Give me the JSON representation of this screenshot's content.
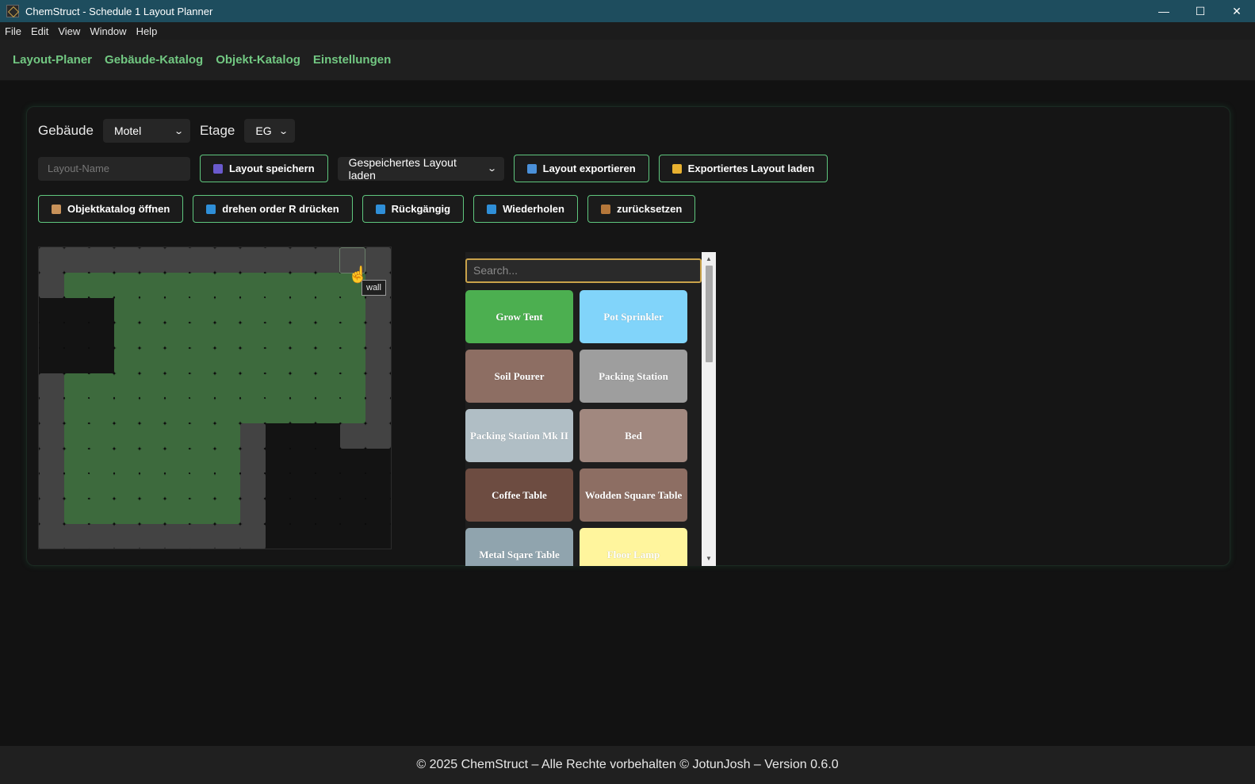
{
  "window": {
    "title": "ChemStruct - Schedule 1 Layout Planner",
    "minimize": "—",
    "maximize": "☐",
    "close": "✕"
  },
  "menu": [
    "File",
    "Edit",
    "View",
    "Window",
    "Help"
  ],
  "nav": [
    "Layout-Planer",
    "Gebäude-Katalog",
    "Objekt-Katalog",
    "Einstellungen"
  ],
  "controls": {
    "building_label": "Gebäude",
    "building_value": "Motel",
    "floor_label": "Etage",
    "floor_value": "EG",
    "layout_name_placeholder": "Layout-Name",
    "save_btn": "Layout speichern",
    "load_saved_select": "Gespeichertes Layout laden",
    "export_btn": "Layout exportieren",
    "load_export_btn": "Exportiertes Layout laden",
    "catalog_btn": "Objektkatalog öffnen",
    "rotate_btn": "drehen order R drücken",
    "undo_btn": "Rückgängig",
    "redo_btn": "Wiederholen",
    "reset_btn": "zurücksetzen"
  },
  "icons": {
    "save": "floppy-disk-icon",
    "export": "outbox-icon",
    "load_export": "folder-icon",
    "catalog": "package-icon",
    "rotate": "rotate-icon",
    "undo": "arrow-left-icon",
    "redo": "arrow-right-icon",
    "reset": "broom-icon"
  },
  "grid": {
    "tooltip": "wall"
  },
  "catalog": {
    "search_placeholder": "Search...",
    "items": [
      {
        "label": "Grow Tent",
        "color": "#4caf50"
      },
      {
        "label": "Pot Sprinkler",
        "color": "#81d4fa"
      },
      {
        "label": "Soil Pourer",
        "color": "#8d6e63"
      },
      {
        "label": "Packing Station",
        "color": "#9e9e9e"
      },
      {
        "label": "Packing Station Mk II",
        "color": "#b0bec5"
      },
      {
        "label": "Bed",
        "color": "#a1887f"
      },
      {
        "label": "Coffee Table",
        "color": "#6d4c41"
      },
      {
        "label": "Wodden Square Table",
        "color": "#8d6e63"
      },
      {
        "label": "Metal Sqare Table",
        "color": "#90a4ae"
      },
      {
        "label": "Floor Lamp",
        "color": "#fff59d"
      }
    ]
  },
  "footer": "© 2025 ChemStruct – Alle Rechte vorbehalten © JotunJosh – Version 0.6.0"
}
